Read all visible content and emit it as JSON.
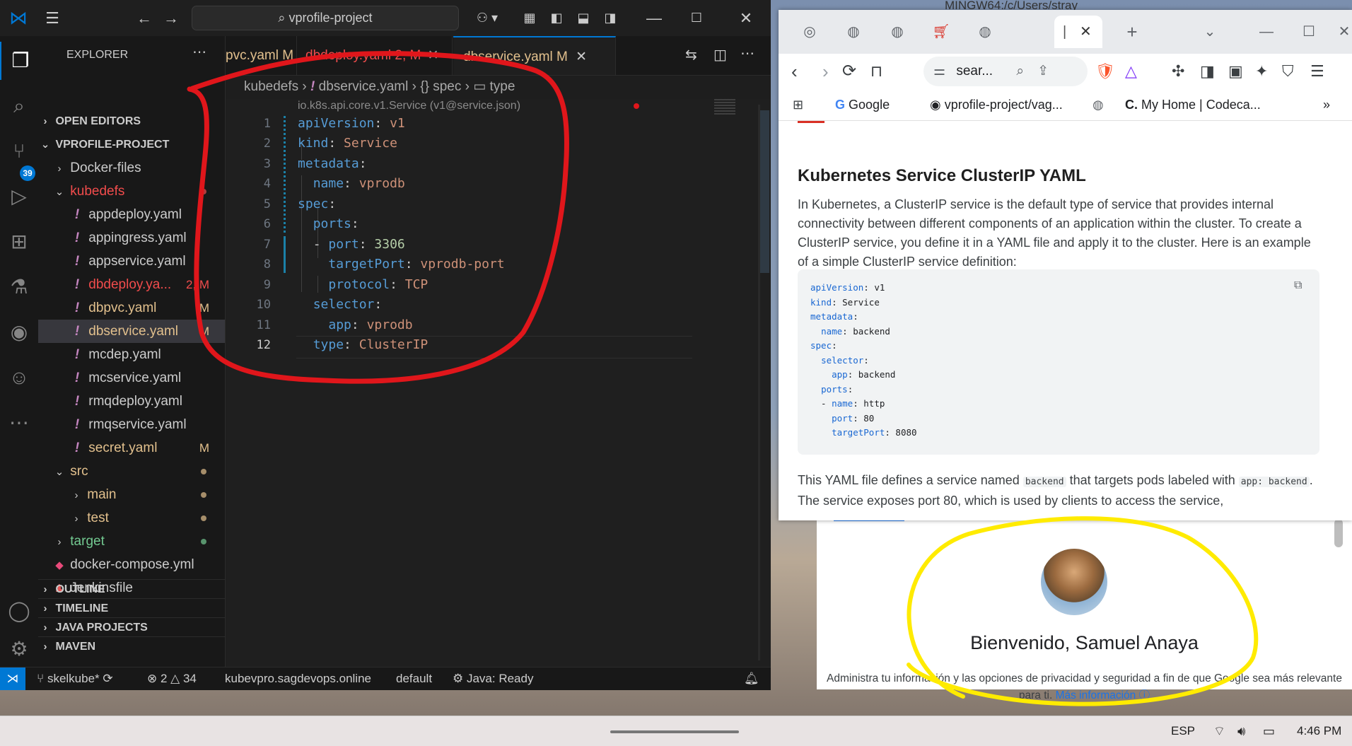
{
  "vscode": {
    "title_search": "vprofile-project",
    "explorer_title": "EXPLORER",
    "open_editors": "OPEN EDITORS",
    "project_root": "VPROFILE-PROJECT",
    "scm_badge": "39",
    "tree": [
      {
        "label": "Docker-files",
        "kind": "folder",
        "expanded": false,
        "depth": 1
      },
      {
        "label": "kubedefs",
        "kind": "folder",
        "expanded": true,
        "depth": 1,
        "style": "err"
      },
      {
        "label": "appdeploy.yaml",
        "kind": "yaml",
        "depth": 2
      },
      {
        "label": "appingress.yaml",
        "kind": "yaml",
        "depth": 2
      },
      {
        "label": "appservice.yaml",
        "kind": "yaml",
        "depth": 2
      },
      {
        "label": "dbdeploy.ya...",
        "kind": "yaml",
        "depth": 2,
        "style": "err",
        "status": "2, M"
      },
      {
        "label": "dbpvc.yaml",
        "kind": "yaml",
        "depth": 2,
        "style": "mod",
        "status": "M"
      },
      {
        "label": "dbservice.yaml",
        "kind": "yaml",
        "depth": 2,
        "style": "mod",
        "status": "M",
        "selected": true
      },
      {
        "label": "mcdep.yaml",
        "kind": "yaml",
        "depth": 2
      },
      {
        "label": "mcservice.yaml",
        "kind": "yaml",
        "depth": 2
      },
      {
        "label": "rmqdeploy.yaml",
        "kind": "yaml",
        "depth": 2
      },
      {
        "label": "rmqservice.yaml",
        "kind": "yaml",
        "depth": 2
      },
      {
        "label": "secret.yaml",
        "kind": "yaml",
        "depth": 2,
        "style": "mod",
        "status": "M"
      },
      {
        "label": "src",
        "kind": "folder",
        "expanded": true,
        "depth": 1,
        "style": "mod"
      },
      {
        "label": "main",
        "kind": "folder",
        "expanded": false,
        "depth": 2,
        "style": "mod"
      },
      {
        "label": "test",
        "kind": "folder",
        "expanded": false,
        "depth": 2,
        "style": "mod"
      },
      {
        "label": "target",
        "kind": "folder",
        "expanded": false,
        "depth": 1,
        "style": "git"
      },
      {
        "label": "docker-compose.yml",
        "kind": "docker",
        "depth": 1
      },
      {
        "label": "Jenkinsfile",
        "kind": "jenkins",
        "depth": 1
      }
    ],
    "panels": [
      "OUTLINE",
      "TIMELINE",
      "JAVA PROJECTS",
      "MAVEN"
    ],
    "tabs": [
      {
        "label": "pvc.yaml",
        "status": "M"
      },
      {
        "label": "dbdeploy.yaml",
        "status": "2, M"
      },
      {
        "label": "dbservice.yaml",
        "status": "M",
        "active": true
      }
    ],
    "breadcrumb": [
      "kubedefs",
      "dbservice.yaml",
      "spec",
      "type"
    ],
    "schema_hint": "io.k8s.api.core.v1.Service (v1@service.json)",
    "code_lines": [
      {
        "n": "1"
      },
      {
        "n": "2"
      },
      {
        "n": "3"
      },
      {
        "n": "4"
      },
      {
        "n": "5"
      },
      {
        "n": "6"
      },
      {
        "n": "7"
      },
      {
        "n": "8"
      },
      {
        "n": "9"
      },
      {
        "n": "10"
      },
      {
        "n": "11"
      },
      {
        "n": "12"
      }
    ],
    "code": {
      "l1k": "apiVersion",
      "l1v": "v1",
      "l2k": "kind",
      "l2v": "Service",
      "l3k": "metadata",
      "l4k": "name",
      "l4v": "vprodb",
      "l5k": "spec",
      "l6k": "ports",
      "l7k": "port",
      "l7v": "3306",
      "l8k": "targetPort",
      "l8v": "vprodb-port",
      "l9k": "protocol",
      "l9v": "TCP",
      "l10k": "selector",
      "l11k": "app",
      "l11v": "vprodb",
      "l12k": "type",
      "l12v": "ClusterIP"
    },
    "status": {
      "branch": "skelkube*",
      "errors": "2",
      "warnings": "34",
      "context": "kubevpro.sagdevops.online",
      "namespace": "default",
      "java": "Java: Ready"
    }
  },
  "browser": {
    "window_behind_title": "MINGW64:/c/Users/stray",
    "url": "sear...",
    "bookmarks": [
      "Google",
      "vprofile-project/vag...",
      "My Home | Codeca..."
    ],
    "article_title": "Kubernetes Service ClusterIP YAML",
    "article_p1": "In Kubernetes, a ClusterIP service is the default type of service that provides internal connectivity between different components of an application within the cluster. To create a ClusterIP service, you define it in a YAML file and apply it to the cluster. Here is an example of a simple ClusterIP service definition:",
    "code_block": "apiVersion: v1\nkind: Service\nmetadata:\n  name: backend\nspec:\n  selector:\n    app: backend\n  ports:\n  - name: http\n    port: 80\n    targetPort: 8080",
    "article_p2_a": "This YAML file defines a service named ",
    "article_p2_code1": "backend",
    "article_p2_b": " that targets pods labeled with ",
    "article_p2_code2": "app: backend",
    "article_p2_c": ". The service exposes port 80, which is used by clients to access the service,"
  },
  "google_account": {
    "welcome": "Bienvenido, Samuel Anaya",
    "desc": "Administra tu información y las opciones de privacidad y seguridad a fin de que Google sea más relevante para ti.",
    "link": "Más información"
  },
  "taskbar": {
    "lang": "ESP",
    "time": "4:46 PM"
  },
  "colors": {
    "vscode_bg": "#1e1e1e",
    "accent": "#0078d4",
    "annotation_red": "#e0161b",
    "annotation_yellow": "#ffeb00"
  }
}
